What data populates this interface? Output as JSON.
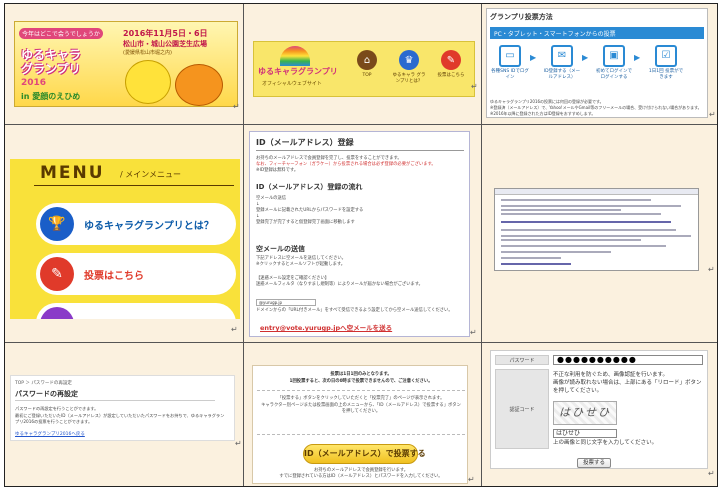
{
  "banner": {
    "ribbon": "今年はどこで会うでしょうか",
    "date": "2016年11月5日・6日",
    "place": "松山市・城山公園芝生広場",
    "sub": "(愛媛県松山市堀之内)",
    "logo_line1": "ゆるキャラ",
    "logo_line2": "グランプリ",
    "logo_line3": "2016",
    "logo_line4": "in 愛顔のえひめ"
  },
  "site_header": {
    "logo": "ゆるキャラグランプリ",
    "sublogo": "オフィシャルウェブサイト",
    "nav": [
      {
        "icon": "⌂",
        "label": "TOP",
        "color": "#7a4a1a"
      },
      {
        "icon": "♛",
        "label": "ゆるキャラ グランプリとは？",
        "color": "#2a6ad0"
      },
      {
        "icon": "✎",
        "label": "投票はこちら",
        "color": "#e03a2a"
      }
    ]
  },
  "vote_method": {
    "title": "グランプリ投票方法",
    "bar": "PC・タブレット・スマートフォンからの投票",
    "steps": [
      {
        "icon": "▭",
        "label": "各種SNS IDでログイン"
      },
      {
        "icon": "✉",
        "label": "ID登録する（メールアドレス）"
      },
      {
        "icon": "▣",
        "label": "初めてログインでログインする"
      },
      {
        "icon": "☑",
        "label": "1日1回 投票ができます"
      }
    ],
    "note1": "ゆるキャラグランプリ2016の投票には何回の登録が必要です。",
    "note2": "※登録済（メールアドレス）で、Yahoo!メールやGmail等のフリーメールの場合、受け付けられない場合があります。",
    "note3": "※2016年以降に登録された方はID登録をおすすめします。"
  },
  "menu": {
    "title": "MENU",
    "subtitle": "/ メインメニュー",
    "items": [
      {
        "icon": "🏆",
        "label": "ゆるキャラグランプリとは？",
        "color": "#1a5ec8"
      },
      {
        "icon": "✎",
        "label": "投票はこちら",
        "color": "#e03a2a"
      }
    ]
  },
  "id_register": {
    "title": "ID（メールアドレス）登録",
    "p1": "お持ちのメールアドレスで会員登録を完了し、投票をすることができます。",
    "p2": "なお、フィーチャーフォン（ガラケー）から投票される場合は必ず登録の必要がございます。",
    "p3": "※ID登録は無料です。",
    "flow_title": "ID（メールアドレス）登録の流れ",
    "flow1": "空メールの送信",
    "flow2": "↓",
    "flow3": "登録メールに記載されたURLからパスワードを設定する",
    "flow4": "↓",
    "flow5": "登録完了が完了すると仮登録完了画面に移動します",
    "send_title": "空メールの送信",
    "send1": "下記アドレスに空メールを送信してください。",
    "send2": "※クリックするとメールソフトが起動します。",
    "warn1": "【迷惑メール設定をご確認ください】",
    "warn2": "迷惑メールフィルタ（なりすまし規制等）によりメールが届かない場合がございます。",
    "domain": "@yurugp.jp",
    "warn3": "ドメインからの「URL付きメール」をすべて受信できるよう設定してから空メール送信してください。",
    "link": "entry@vote.yurugp.jpへ空メールを送る"
  },
  "pw_reset": {
    "breadcrumb": "TOP ＞ パスワードの再設定",
    "title": "パスワードの再設定",
    "p1": "パスワードの再設定を行うことができます。",
    "p2": "最初にご登録いただいたID（メールアドレス）が設定していただいたパスワードをお持ちで、ゆるキャラグランプリ2016の投票を行うことができます。",
    "link": "ゆるキャラグランプリ2016へ戻る"
  },
  "vote_now": {
    "line1": "投票は1日1回のみとなります。",
    "line2": "1回投票すると、次の日の0時まで投票できませんので、ご注意ください。",
    "line3": "「投票する」ボタンをクリックしていただくと「投票完了」のページが表示されます。",
    "line4": "キャラクター別ページまたは投票画面の上のメニューから、「ID（メールアドレス）で投票する」ボタンを押してください。",
    "button": "ID（メールアドレス）で投票する",
    "line5": "お持ちのメールアドレスで会員登録を行います。",
    "line6": "すでに登録されている方はID（メールアドレス）とパスワードを入力してください。"
  },
  "pw_form": {
    "password_label": "パスワード",
    "password_value": "●●●●●●●●●●",
    "captcha_label": "認証コード",
    "captcha_text1": "不正な利用を防ぐため、画像認証を行います。",
    "captcha_text2": "画像が読み取れない場合は、上部にある「リロード」ボタンを押してください。",
    "captcha_image": "はひせひ",
    "captcha_input": "はひせひ",
    "captcha_hint": "上の画像と同じ文字を入力してください。",
    "submit": "投票する"
  }
}
